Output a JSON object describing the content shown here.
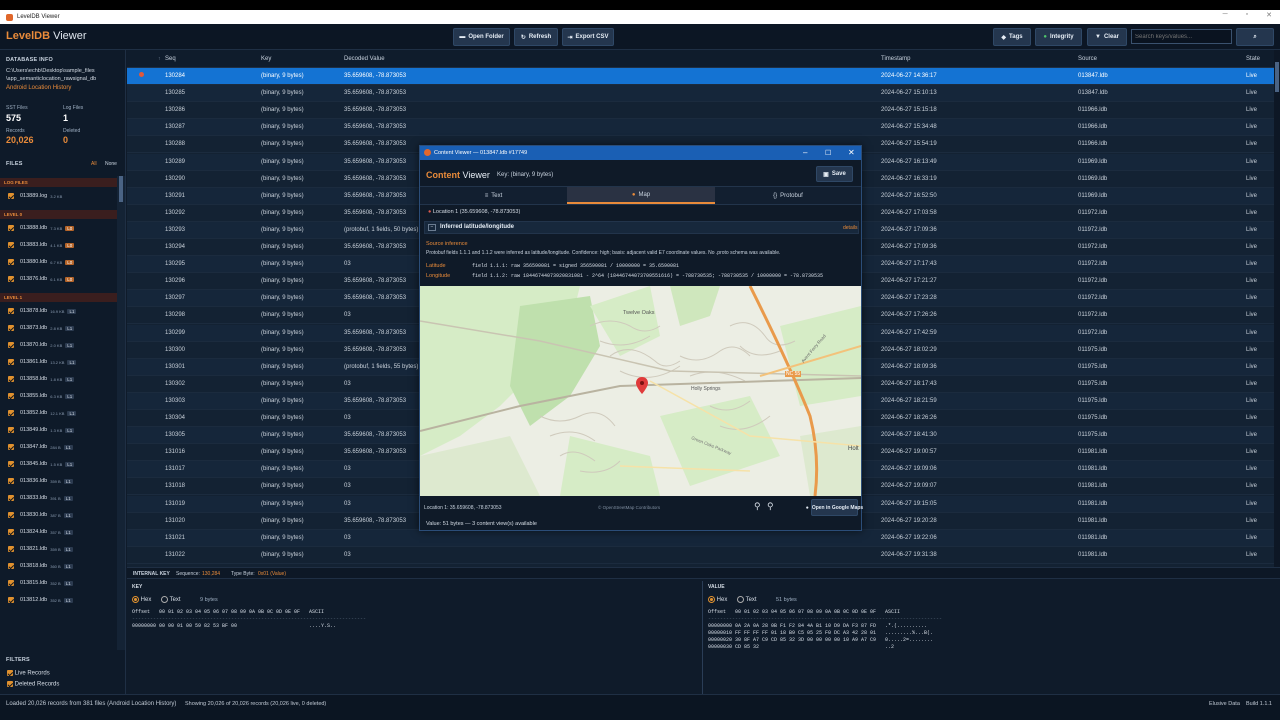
{
  "window": {
    "title": "LevelDB Viewer"
  },
  "toolbar": {
    "logo_bold": "LevelDB",
    "logo_rest": " Viewer",
    "open_folder": "Open Folder",
    "refresh": "Refresh",
    "export_csv": "Export CSV",
    "tags": "Tags",
    "integrity": "Integrity",
    "clear": "Clear",
    "search_placeholder": "Search keys/values...",
    "accent": "#e98b3a"
  },
  "sidebar": {
    "db_info_title": "DATABASE INFO",
    "path_line1": "C:\\Users\\echb\\Desktop\\sample_files",
    "path_line2": "\\app_semanticlocation_rawsignal_db",
    "db_name": "Android Location History",
    "sst_label": "SST Files",
    "sst_value": "575",
    "log_label": "Log Files",
    "log_value": "1",
    "records_label": "Records",
    "records_value": "20,026",
    "deleted_label": "Deleted",
    "deleted_value": "0",
    "files_title": "FILES",
    "all": "All",
    "none": "None",
    "groups": [
      {
        "label": "LOG FILES",
        "files": [
          {
            "name": "013889.log",
            "size": "3.2 KB",
            "tag": ""
          }
        ]
      },
      {
        "label": "LEVEL 0",
        "files": [
          {
            "name": "013888.ldb",
            "size": "7.3 KB",
            "tag": "L0"
          },
          {
            "name": "013883.ldb",
            "size": "4.1 KB",
            "tag": "L0"
          },
          {
            "name": "013880.ldb",
            "size": "6.7 KB",
            "tag": "L0"
          },
          {
            "name": "013876.ldb",
            "size": "6.1 KB",
            "tag": "L0"
          }
        ]
      },
      {
        "label": "LEVEL 1",
        "files": [
          {
            "name": "013878.ldb",
            "size": "16.9 KB",
            "tag": "L1"
          },
          {
            "name": "013873.ldb",
            "size": "2.8 KB",
            "tag": "L1"
          },
          {
            "name": "013870.ldb",
            "size": "2.0 KB",
            "tag": "L1"
          },
          {
            "name": "013861.ldb",
            "size": "13.2 KB",
            "tag": "L1"
          },
          {
            "name": "013858.ldb",
            "size": "1.8 KB",
            "tag": "L1"
          },
          {
            "name": "013855.ldb",
            "size": "6.3 KB",
            "tag": "L1"
          },
          {
            "name": "013852.ldb",
            "size": "12.1 KB",
            "tag": "L1"
          },
          {
            "name": "013849.ldb",
            "size": "1.3 KB",
            "tag": "L1"
          },
          {
            "name": "013847.ldb",
            "size": "284 B",
            "tag": "L1"
          },
          {
            "name": "013845.ldb",
            "size": "1.5 KB",
            "tag": "L1"
          },
          {
            "name": "013836.ldb",
            "size": "359 B",
            "tag": "L1"
          },
          {
            "name": "013833.ldb",
            "size": "391 B",
            "tag": "L1"
          },
          {
            "name": "013830.ldb",
            "size": "387 B",
            "tag": "L1"
          },
          {
            "name": "013824.ldb",
            "size": "357 B",
            "tag": "L1"
          },
          {
            "name": "013821.ldb",
            "size": "359 B",
            "tag": "L1"
          },
          {
            "name": "013818.ldb",
            "size": "360 B",
            "tag": "L1"
          },
          {
            "name": "013815.ldb",
            "size": "352 B",
            "tag": "L1"
          },
          {
            "name": "013812.ldb",
            "size": "352 B",
            "tag": "L1"
          }
        ]
      }
    ],
    "filters_title": "FILTERS",
    "live_records": "Live Records",
    "deleted_records": "Deleted Records"
  },
  "grid": {
    "columns": [
      "Seq",
      "Key",
      "Decoded Value",
      "Timestamp",
      "Source",
      "State"
    ],
    "rows": [
      [
        "130284",
        "(binary, 9 bytes)",
        "35.659608, -78.873053",
        "2024-06-27 14:36:17",
        "013847.ldb",
        "Live"
      ],
      [
        "130285",
        "(binary, 9 bytes)",
        "35.659608, -78.873053",
        "2024-06-27 15:10:13",
        "013847.ldb",
        "Live"
      ],
      [
        "130286",
        "(binary, 9 bytes)",
        "35.659608, -78.873053",
        "2024-06-27 15:15:18",
        "011966.ldb",
        "Live"
      ],
      [
        "130287",
        "(binary, 9 bytes)",
        "35.659608, -78.873053",
        "2024-06-27 15:34:48",
        "011966.ldb",
        "Live"
      ],
      [
        "130288",
        "(binary, 9 bytes)",
        "35.659608, -78.873053",
        "2024-06-27 15:54:19",
        "011966.ldb",
        "Live"
      ],
      [
        "130289",
        "(binary, 9 bytes)",
        "35.659608, -78.873053",
        "2024-06-27 16:13:49",
        "011969.ldb",
        "Live"
      ],
      [
        "130290",
        "(binary, 9 bytes)",
        "35.659608, -78.873053",
        "2024-06-27 16:33:19",
        "011969.ldb",
        "Live"
      ],
      [
        "130291",
        "(binary, 9 bytes)",
        "35.659608, -78.873053",
        "2024-06-27 16:52:50",
        "011969.ldb",
        "Live"
      ],
      [
        "130292",
        "(binary, 9 bytes)",
        "35.659608, -78.873053",
        "2024-06-27 17:03:58",
        "011972.ldb",
        "Live"
      ],
      [
        "130293",
        "(binary, 9 bytes)",
        "(protobuf, 1 fields, 50 bytes)",
        "2024-06-27 17:09:36",
        "011972.ldb",
        "Live"
      ],
      [
        "130294",
        "(binary, 9 bytes)",
        "35.659608, -78.873053",
        "2024-06-27 17:09:36",
        "011972.ldb",
        "Live"
      ],
      [
        "130295",
        "(binary, 9 bytes)",
        "03",
        "2024-06-27 17:17:43",
        "011972.ldb",
        "Live"
      ],
      [
        "130296",
        "(binary, 9 bytes)",
        "35.659608, -78.873053",
        "2024-06-27 17:21:27",
        "011972.ldb",
        "Live"
      ],
      [
        "130297",
        "(binary, 9 bytes)",
        "35.659608, -78.873053",
        "2024-06-27 17:23:28",
        "011972.ldb",
        "Live"
      ],
      [
        "130298",
        "(binary, 9 bytes)",
        "03",
        "2024-06-27 17:26:26",
        "011972.ldb",
        "Live"
      ],
      [
        "130299",
        "(binary, 9 bytes)",
        "35.659608, -78.873053",
        "2024-06-27 17:42:59",
        "011972.ldb",
        "Live"
      ],
      [
        "130300",
        "(binary, 9 bytes)",
        "35.659608, -78.873053",
        "2024-06-27 18:02:29",
        "011975.ldb",
        "Live"
      ],
      [
        "130301",
        "(binary, 9 bytes)",
        "(protobuf, 1 fields, 55 bytes)",
        "2024-06-27 18:09:36",
        "011975.ldb",
        "Live"
      ],
      [
        "130302",
        "(binary, 9 bytes)",
        "03",
        "2024-06-27 18:17:43",
        "011975.ldb",
        "Live"
      ],
      [
        "130303",
        "(binary, 9 bytes)",
        "35.659608, -78.873053",
        "2024-06-27 18:21:59",
        "011975.ldb",
        "Live"
      ],
      [
        "130304",
        "(binary, 9 bytes)",
        "03",
        "2024-06-27 18:26:26",
        "011975.ldb",
        "Live"
      ],
      [
        "130305",
        "(binary, 9 bytes)",
        "35.659608, -78.873053",
        "2024-06-27 18:41:30",
        "011975.ldb",
        "Live"
      ],
      [
        "131016",
        "(binary, 9 bytes)",
        "35.659608, -78.873053",
        "2024-06-27 19:00:57",
        "011981.ldb",
        "Live"
      ],
      [
        "131017",
        "(binary, 9 bytes)",
        "03",
        "2024-06-27 19:09:06",
        "011981.ldb",
        "Live"
      ],
      [
        "131018",
        "(binary, 9 bytes)",
        "03",
        "2024-06-27 19:09:07",
        "011981.ldb",
        "Live"
      ],
      [
        "131019",
        "(binary, 9 bytes)",
        "03",
        "2024-06-27 19:15:05",
        "011981.ldb",
        "Live"
      ],
      [
        "131020",
        "(binary, 9 bytes)",
        "35.659608, -78.873053",
        "2024-06-27 19:20:28",
        "011981.ldb",
        "Live"
      ],
      [
        "131021",
        "(binary, 9 bytes)",
        "03",
        "2024-06-27 19:22:06",
        "011981.ldb",
        "Live"
      ],
      [
        "131022",
        "(binary, 9 bytes)",
        "03",
        "2024-06-27 19:31:38",
        "011981.ldb",
        "Live"
      ]
    ]
  },
  "bottom": {
    "internal_key": "INTERNAL KEY",
    "sequence_label": "Sequence:",
    "sequence_value": "130,284",
    "typebyte_label": "Type Byte:",
    "typebyte_value": "0x01 (Value)",
    "key_title": "KEY",
    "value_title": "VALUE",
    "hex": "Hex",
    "text": "Text",
    "key_bytes": "9 bytes",
    "value_bytes": "51 bytes",
    "key_header": "Offset   00 01 02 03 04 05 06 07 08 09 0A 0B 0C 0D 0E 0F   ASCII",
    "key_sep": "------------------------------------------------------------------------------",
    "key_lines": [
      "00000000 00 00 01 00 59 82 53 BF 00                        ....Y.S.."
    ],
    "value_header": "Offset   00 01 02 03 04 05 06 07 08 09 0A 0B 0C 0D 0E 0F   ASCII",
    "value_sep": "------------------------------------------------------------------------------",
    "value_lines": [
      "00000000 0A 2A 0A 28 0B F1 F2 84 4A B1 10 D9 DA F3 87 FD   .*.(..........",
      "00000010 FF FF FF FF 01 18 B9 C5 05 25 F0 DC A3 42 28 01   .........%...B(.",
      "00000020 30 8F A7 C9 CD 85 32 3D 00 00 00 00 10 A9 A7 C9   0.....2=........",
      "00000030 CD 85 32                                          ..2"
    ]
  },
  "status": {
    "left": "Loaded 20,026 records from 381 files (Android Location History)",
    "middle": "Showing 20,026 of 20,026 records (20,026 live, 0 deleted)",
    "vendor": "Elusive Data",
    "build": "Build 1.1.1"
  },
  "dialog": {
    "title": "Content Viewer — 013847.ldb #17749",
    "header_bold": "Content",
    "header_rest": " Viewer",
    "key_info": "Key: (binary, 9 bytes)",
    "save": "Save",
    "tabs": [
      "Text",
      "Map",
      "Protobuf"
    ],
    "location_line": "Location 1 (35.659608, -78.873053)",
    "inferred_title": "Inferred latitude/longitude",
    "details": "details",
    "source_title": "Source inference",
    "source_text": "Protobuf fields 1.1.1 and 1.1.2 were inferred as latitude/longitude. Confidence: high; basis: adjacent valid E7 coordinate values. No .proto schema was available.",
    "lat_label": "Latitude",
    "lat_value": "field 1.1.1: raw 356590081 = signed 356590081 / 10000000 = 35.6590081",
    "lon_label": "Longitude",
    "lon_value": "field 1.1.2: raw 18446744073920831081 - 2^64 (18446744073709551616) = -788730535; -788730535 / 10000000 = -78.8730535",
    "map_labels": [
      "Twelve Oaks",
      "Holly Springs",
      "Green Oaks Parkway",
      "NC 55",
      "Holt",
      "Avent Ferry Road"
    ],
    "location_footer": "Location 1: 35.659608, -78.873053",
    "osm": "© OpenStreetMap Contributors",
    "open_maps": "Open in Google Maps",
    "value_info": "Value: 51 bytes — 3 content view(s) available",
    "accent": "#e98b3a",
    "title_color": "#1a5fb4"
  }
}
